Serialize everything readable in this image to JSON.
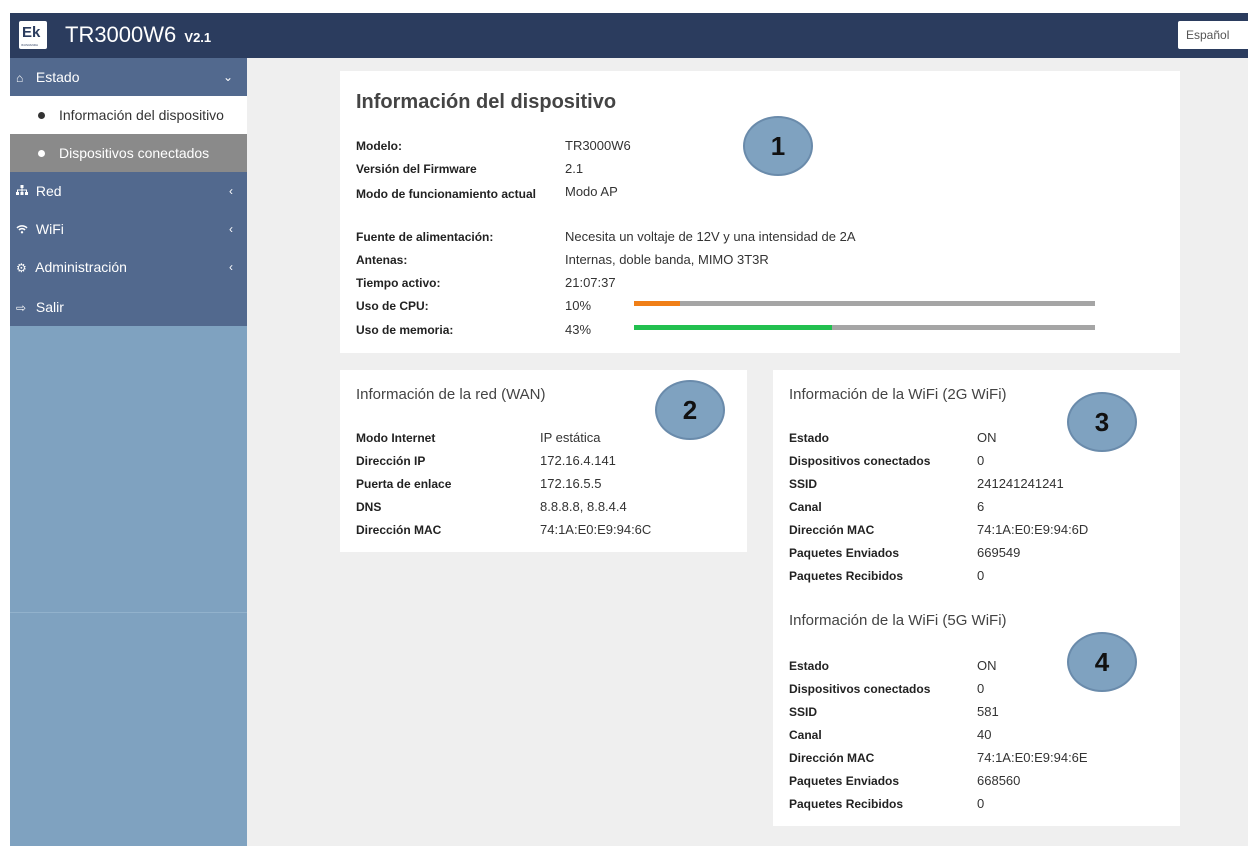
{
  "header": {
    "logo_text": "Ek",
    "logo_subtext": "IKUSI/ANDA",
    "title": "TR3000W6",
    "version": "V2.1",
    "language": "Español"
  },
  "sidebar": {
    "sections": [
      {
        "label": "Estado",
        "icon": "home-icon",
        "chevron": "⌄"
      },
      {
        "label": "Red",
        "icon": "sitemap-icon",
        "chevron": "‹"
      },
      {
        "label": "WiFi",
        "icon": "wifi-icon",
        "chevron": "‹"
      },
      {
        "label": "Administración",
        "icon": "gear-icon",
        "chevron": "‹"
      },
      {
        "label": "Salir",
        "icon": "logout-icon"
      }
    ],
    "sub_items": [
      {
        "label": "Información del dispositivo"
      },
      {
        "label": "Dispositivos conectados"
      }
    ]
  },
  "device": {
    "title": "Información del dispositivo",
    "rows": [
      {
        "label": "Modelo:",
        "value": "TR3000W6"
      },
      {
        "label": "Versión del Firmware",
        "value": "2.1"
      },
      {
        "label": "Modo de funcionamiento actual",
        "value": "Modo AP"
      },
      {
        "label": "Fuente de alimentación:",
        "value": "Necesita un voltaje de 12V y una intensidad de 2A"
      },
      {
        "label": "Antenas:",
        "value": "Internas, doble banda, MIMO 3T3R"
      },
      {
        "label": "Tiempo activo:",
        "value": "21:07:37"
      },
      {
        "label": "Uso de CPU:",
        "value": "10%"
      },
      {
        "label": "Uso de memoria:",
        "value": "43%"
      }
    ],
    "cpu_usage": 0.1,
    "memory_usage": 0.43
  },
  "wan": {
    "title": "Información de la red (WAN)",
    "rows": [
      {
        "label": "Modo Internet",
        "value": "IP estática"
      },
      {
        "label": "Dirección IP",
        "value": "172.16.4.141"
      },
      {
        "label": "Puerta de enlace",
        "value": "172.16.5.5"
      },
      {
        "label": "DNS",
        "value": "8.8.8.8, 8.8.4.4"
      },
      {
        "label": "Dirección MAC",
        "value": "74:1A:E0:E9:94:6C"
      }
    ]
  },
  "wifi2g": {
    "title": "Información de la WiFi (2G WiFi)",
    "rows": [
      {
        "label": "Estado",
        "value": "ON"
      },
      {
        "label": "Dispositivos conectados",
        "value": "0"
      },
      {
        "label": "SSID",
        "value": "241241241241"
      },
      {
        "label": "Canal",
        "value": "6"
      },
      {
        "label": "Dirección MAC",
        "value": "74:1A:E0:E9:94:6D"
      },
      {
        "label": "Paquetes Enviados",
        "value": "669549"
      },
      {
        "label": "Paquetes Recibidos",
        "value": "0"
      }
    ]
  },
  "wifi5g": {
    "title": "Información de la WiFi (5G WiFi)",
    "rows": [
      {
        "label": "Estado",
        "value": "ON"
      },
      {
        "label": "Dispositivos conectados",
        "value": "0"
      },
      {
        "label": "SSID",
        "value": "581"
      },
      {
        "label": "Canal",
        "value": "40"
      },
      {
        "label": "Dirección MAC",
        "value": "74:1A:E0:E9:94:6E"
      },
      {
        "label": "Paquetes Enviados",
        "value": "668560"
      },
      {
        "label": "Paquetes Recibidos",
        "value": "0"
      }
    ]
  },
  "callouts": [
    "1",
    "2",
    "3",
    "4"
  ],
  "colors": {
    "header_bg": "#2b3c5e",
    "sidebar_menu_bg": "#52698e",
    "sidebar_bg": "#7fa2c0",
    "cpu_bar": "#f07f17",
    "memory_bar": "#22c04f",
    "bar_track": "#a5a5a5",
    "callout_bg": "#7fa2c0"
  }
}
